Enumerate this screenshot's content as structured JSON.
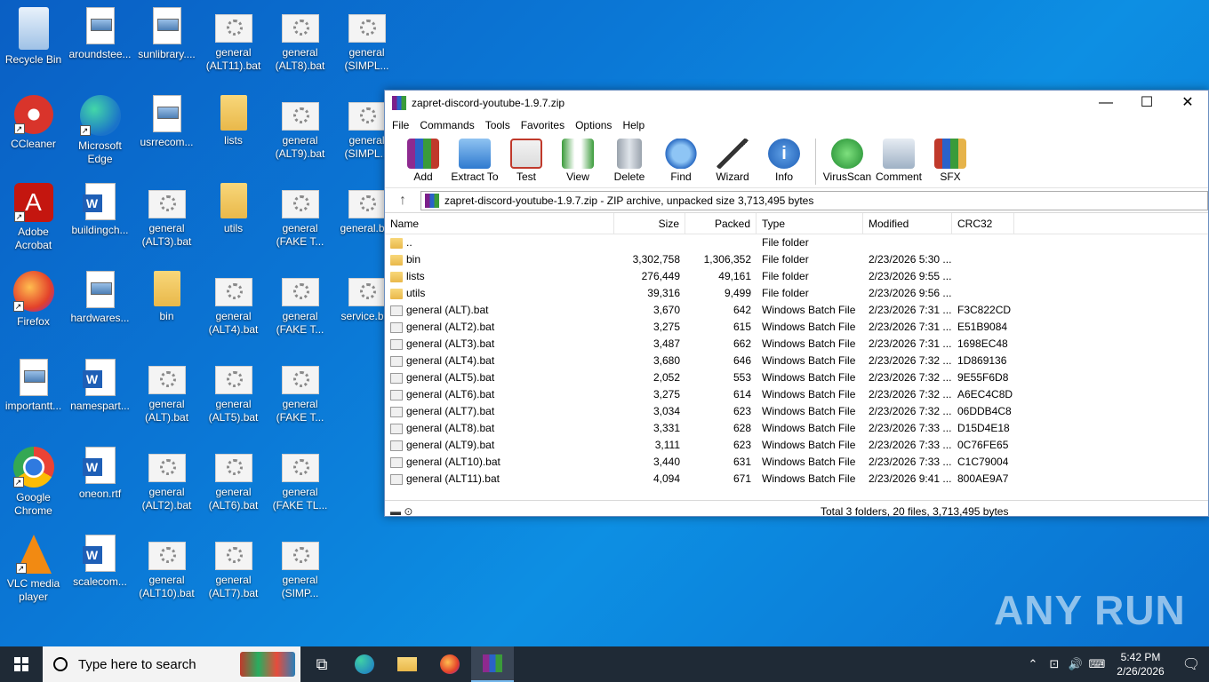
{
  "desktop": {
    "icons": [
      {
        "label": "Recycle Bin"
      },
      {
        "label": "aroundstee..."
      },
      {
        "label": "sunlibrary...."
      },
      {
        "label": "general (ALT11).bat"
      },
      {
        "label": "general (ALT8).bat"
      },
      {
        "label": "general (SIMPL..."
      },
      {
        "label": "CCleaner"
      },
      {
        "label": "Microsoft Edge"
      },
      {
        "label": "usrrecom..."
      },
      {
        "label": "lists"
      },
      {
        "label": "general (ALT9).bat"
      },
      {
        "label": "general (SIMPL..."
      },
      {
        "label": "Adobe Acrobat"
      },
      {
        "label": "buildingch..."
      },
      {
        "label": "general (ALT3).bat"
      },
      {
        "label": "utils"
      },
      {
        "label": "general (FAKE T..."
      },
      {
        "label": "general.b..."
      },
      {
        "label": "Firefox"
      },
      {
        "label": "hardwares..."
      },
      {
        "label": "bin"
      },
      {
        "label": "general (ALT4).bat"
      },
      {
        "label": "general (FAKE T..."
      },
      {
        "label": "service.b..."
      },
      {
        "label": "importantt..."
      },
      {
        "label": "namespart..."
      },
      {
        "label": "general (ALT).bat"
      },
      {
        "label": "general (ALT5).bat"
      },
      {
        "label": "general (FAKE T..."
      },
      {
        "label": "Google Chrome"
      },
      {
        "label": "oneon.rtf"
      },
      {
        "label": "general (ALT2).bat"
      },
      {
        "label": "general (ALT6).bat"
      },
      {
        "label": "general (FAKE TL..."
      },
      {
        "label": "VLC media player"
      },
      {
        "label": "scalecom..."
      },
      {
        "label": "general (ALT10).bat"
      },
      {
        "label": "general (ALT7).bat"
      },
      {
        "label": "general (SIMP..."
      }
    ]
  },
  "window": {
    "title": "zapret-discord-youtube-1.9.7.zip",
    "minimize": "—",
    "maximize": "☐",
    "close": "✕",
    "menu": [
      "File",
      "Commands",
      "Tools",
      "Favorites",
      "Options",
      "Help"
    ],
    "toolbar": [
      "Add",
      "Extract To",
      "Test",
      "View",
      "Delete",
      "Find",
      "Wizard",
      "Info",
      "VirusScan",
      "Comment",
      "SFX"
    ],
    "up_arrow": "↑",
    "path": "zapret-discord-youtube-1.9.7.zip - ZIP archive, unpacked size 3,713,495 bytes",
    "columns": {
      "name": "Name",
      "size": "Size",
      "packed": "Packed",
      "type": "Type",
      "modified": "Modified",
      "crc": "CRC32"
    },
    "rows": [
      {
        "name": "..",
        "size": "",
        "packed": "",
        "type": "File folder",
        "modified": "",
        "crc": "",
        "kind": "folder"
      },
      {
        "name": "bin",
        "size": "3,302,758",
        "packed": "1,306,352",
        "type": "File folder",
        "modified": "2/23/2026 5:30 ...",
        "crc": "",
        "kind": "folder"
      },
      {
        "name": "lists",
        "size": "276,449",
        "packed": "49,161",
        "type": "File folder",
        "modified": "2/23/2026 9:55 ...",
        "crc": "",
        "kind": "folder"
      },
      {
        "name": "utils",
        "size": "39,316",
        "packed": "9,499",
        "type": "File folder",
        "modified": "2/23/2026 9:56 ...",
        "crc": "",
        "kind": "folder"
      },
      {
        "name": "general (ALT).bat",
        "size": "3,670",
        "packed": "642",
        "type": "Windows Batch File",
        "modified": "2/23/2026 7:31 ...",
        "crc": "F3C822CD",
        "kind": "bat"
      },
      {
        "name": "general (ALT2).bat",
        "size": "3,275",
        "packed": "615",
        "type": "Windows Batch File",
        "modified": "2/23/2026 7:31 ...",
        "crc": "E51B9084",
        "kind": "bat"
      },
      {
        "name": "general (ALT3).bat",
        "size": "3,487",
        "packed": "662",
        "type": "Windows Batch File",
        "modified": "2/23/2026 7:31 ...",
        "crc": "1698EC48",
        "kind": "bat"
      },
      {
        "name": "general (ALT4).bat",
        "size": "3,680",
        "packed": "646",
        "type": "Windows Batch File",
        "modified": "2/23/2026 7:32 ...",
        "crc": "1D869136",
        "kind": "bat"
      },
      {
        "name": "general (ALT5).bat",
        "size": "2,052",
        "packed": "553",
        "type": "Windows Batch File",
        "modified": "2/23/2026 7:32 ...",
        "crc": "9E55F6D8",
        "kind": "bat"
      },
      {
        "name": "general (ALT6).bat",
        "size": "3,275",
        "packed": "614",
        "type": "Windows Batch File",
        "modified": "2/23/2026 7:32 ...",
        "crc": "A6EC4C8D",
        "kind": "bat"
      },
      {
        "name": "general (ALT7).bat",
        "size": "3,034",
        "packed": "623",
        "type": "Windows Batch File",
        "modified": "2/23/2026 7:32 ...",
        "crc": "06DDB4C8",
        "kind": "bat"
      },
      {
        "name": "general (ALT8).bat",
        "size": "3,331",
        "packed": "628",
        "type": "Windows Batch File",
        "modified": "2/23/2026 7:33 ...",
        "crc": "D15D4E18",
        "kind": "bat"
      },
      {
        "name": "general (ALT9).bat",
        "size": "3,111",
        "packed": "623",
        "type": "Windows Batch File",
        "modified": "2/23/2026 7:33 ...",
        "crc": "0C76FE65",
        "kind": "bat"
      },
      {
        "name": "general (ALT10).bat",
        "size": "3,440",
        "packed": "631",
        "type": "Windows Batch File",
        "modified": "2/23/2026 7:33 ...",
        "crc": "C1C79004",
        "kind": "bat"
      },
      {
        "name": "general (ALT11).bat",
        "size": "4,094",
        "packed": "671",
        "type": "Windows Batch File",
        "modified": "2/23/2026 9:41 ...",
        "crc": "800AE9A7",
        "kind": "bat"
      }
    ],
    "status": "Total 3 folders, 20 files, 3,713,495 bytes"
  },
  "watermark": "ANY RUN",
  "taskbar": {
    "search_placeholder": "Type here to search",
    "time": "5:42 PM",
    "date": "2/26/2026"
  }
}
